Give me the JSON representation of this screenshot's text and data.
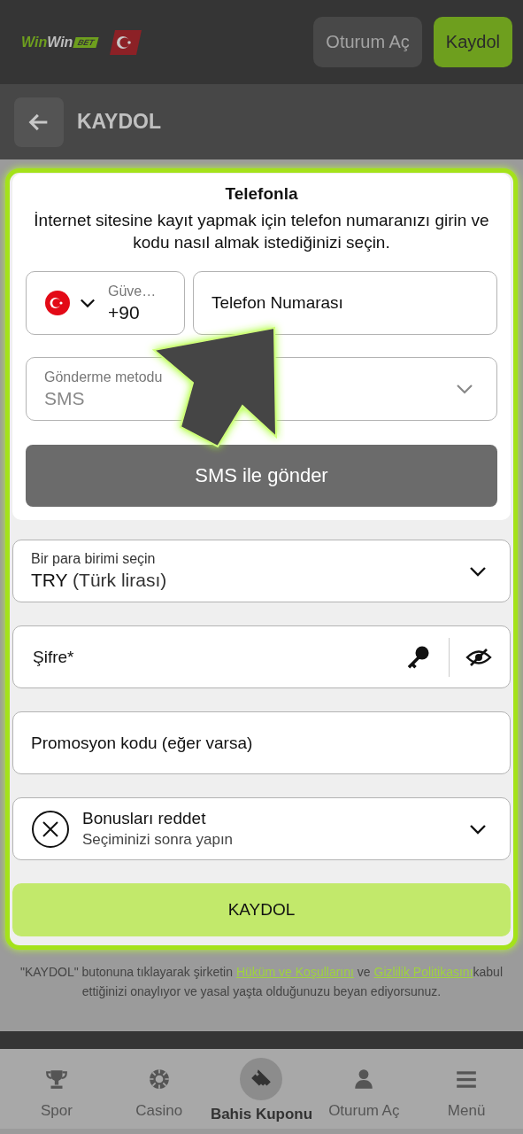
{
  "header": {
    "logo": [
      {
        "kind": "green",
        "text": "Win"
      },
      {
        "kind": "white",
        "text": "Win"
      },
      {
        "kind": "tag",
        "text": "BET"
      }
    ],
    "buttons": [
      {
        "kind": "secondary",
        "label": "Oturum Aç"
      },
      {
        "kind": "primary",
        "label": "Kaydol"
      }
    ]
  },
  "subheader": {
    "title": "KAYDOL"
  },
  "phone_panel": {
    "title": "Telefonla",
    "description": "İnternet sitesine kayıt yapmak için telefon numaranızı girin ve kodu nasıl almak istediğinizi seçin.",
    "country": {
      "label": "Güve…",
      "code": "+90"
    },
    "phone_field": {
      "placeholder": "Telefon Numarası"
    },
    "send_method": {
      "label": "Gönderme metodu",
      "value": "SMS"
    },
    "send_button": "SMS ile gönder"
  },
  "currency": {
    "label": "Bir para birimi seçin",
    "value": "TRY",
    "note": "(Türk lirası)"
  },
  "password": {
    "placeholder": "Şifre*"
  },
  "promo": {
    "placeholder": "Promosyon kodu (eğer varsa)"
  },
  "bonus": {
    "title": "Bonusları reddet",
    "subtitle": "Seçiminizi sonra yapın"
  },
  "submit": "KAYDOL",
  "disclaimer": [
    {
      "kind": "text",
      "text": "\"KAYDOL\" butonuna tıklayarak şirketin "
    },
    {
      "kind": "link",
      "text": "Hüküm ve Koşullarını"
    },
    {
      "kind": "text",
      "text": " ve "
    },
    {
      "kind": "link",
      "text": "Gizlilik Politikasını"
    },
    {
      "kind": "text",
      "text": "kabul ettiğinizi onaylıyor ve yasal yaşta olduğunuzu beyan ediyorsunuz."
    }
  ],
  "nav": [
    {
      "kind": "trophy",
      "label": "Spor",
      "selected": false
    },
    {
      "kind": "chip",
      "label": "Casino",
      "selected": false
    },
    {
      "kind": "ticket",
      "label": "Bahis Kuponu",
      "selected": true
    },
    {
      "kind": "person",
      "label": "Oturum Aç",
      "selected": false
    },
    {
      "kind": "menu",
      "label": "Menü",
      "selected": false
    }
  ]
}
